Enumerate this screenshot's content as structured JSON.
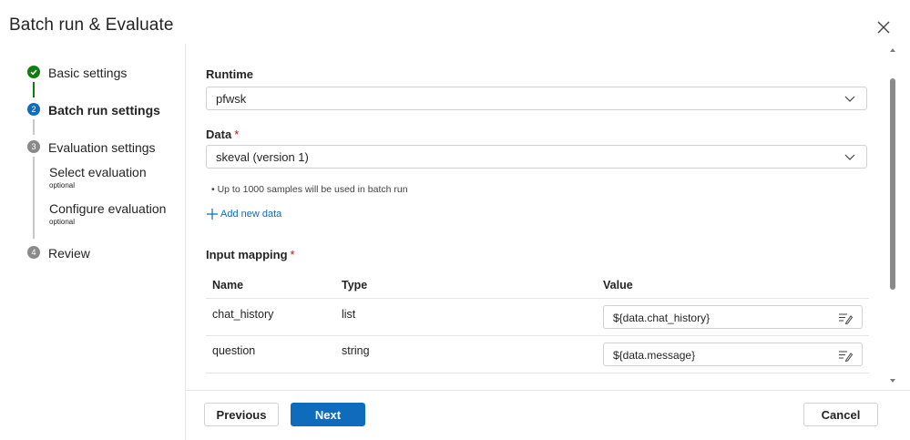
{
  "dialog": {
    "title": "Batch run & Evaluate"
  },
  "steps": [
    {
      "number": "",
      "label": "Basic settings",
      "state": "complete"
    },
    {
      "number": "2",
      "label": "Batch run settings",
      "state": "active"
    },
    {
      "number": "3",
      "label": "Evaluation settings",
      "state": "pending"
    },
    {
      "number": "4",
      "label": "Review",
      "state": "pending"
    }
  ],
  "substeps": [
    {
      "label": "Select evaluation",
      "tag": "optional"
    },
    {
      "label": "Configure evaluation",
      "tag": "optional"
    }
  ],
  "form": {
    "runtime": {
      "label": "Runtime",
      "value": "pfwsk"
    },
    "data": {
      "label": "Data",
      "required": "*",
      "value": "skeval (version 1)",
      "hint": "Up to 1000 samples will be used in batch run",
      "add_label": "Add new data"
    },
    "input_mapping": {
      "label": "Input mapping",
      "required": "*",
      "columns": [
        "Name",
        "Type",
        "Value"
      ],
      "rows": [
        {
          "name": "chat_history",
          "type": "list",
          "value": "${data.chat_history}"
        },
        {
          "name": "question",
          "type": "string",
          "value": "${data.message}"
        }
      ]
    }
  },
  "footer": {
    "previous_label": "Previous",
    "next_label": "Next",
    "cancel_label": "Cancel"
  },
  "colors": {
    "accent": "#0f6cbd",
    "success": "#107c10",
    "pending": "#8a8a8a",
    "required": "#c50f1f"
  },
  "icons": {
    "close": "close-icon",
    "complete": "checkmark-icon",
    "dropdown": "chevron-down-icon",
    "add": "plus-icon",
    "edit": "edit-icon"
  }
}
